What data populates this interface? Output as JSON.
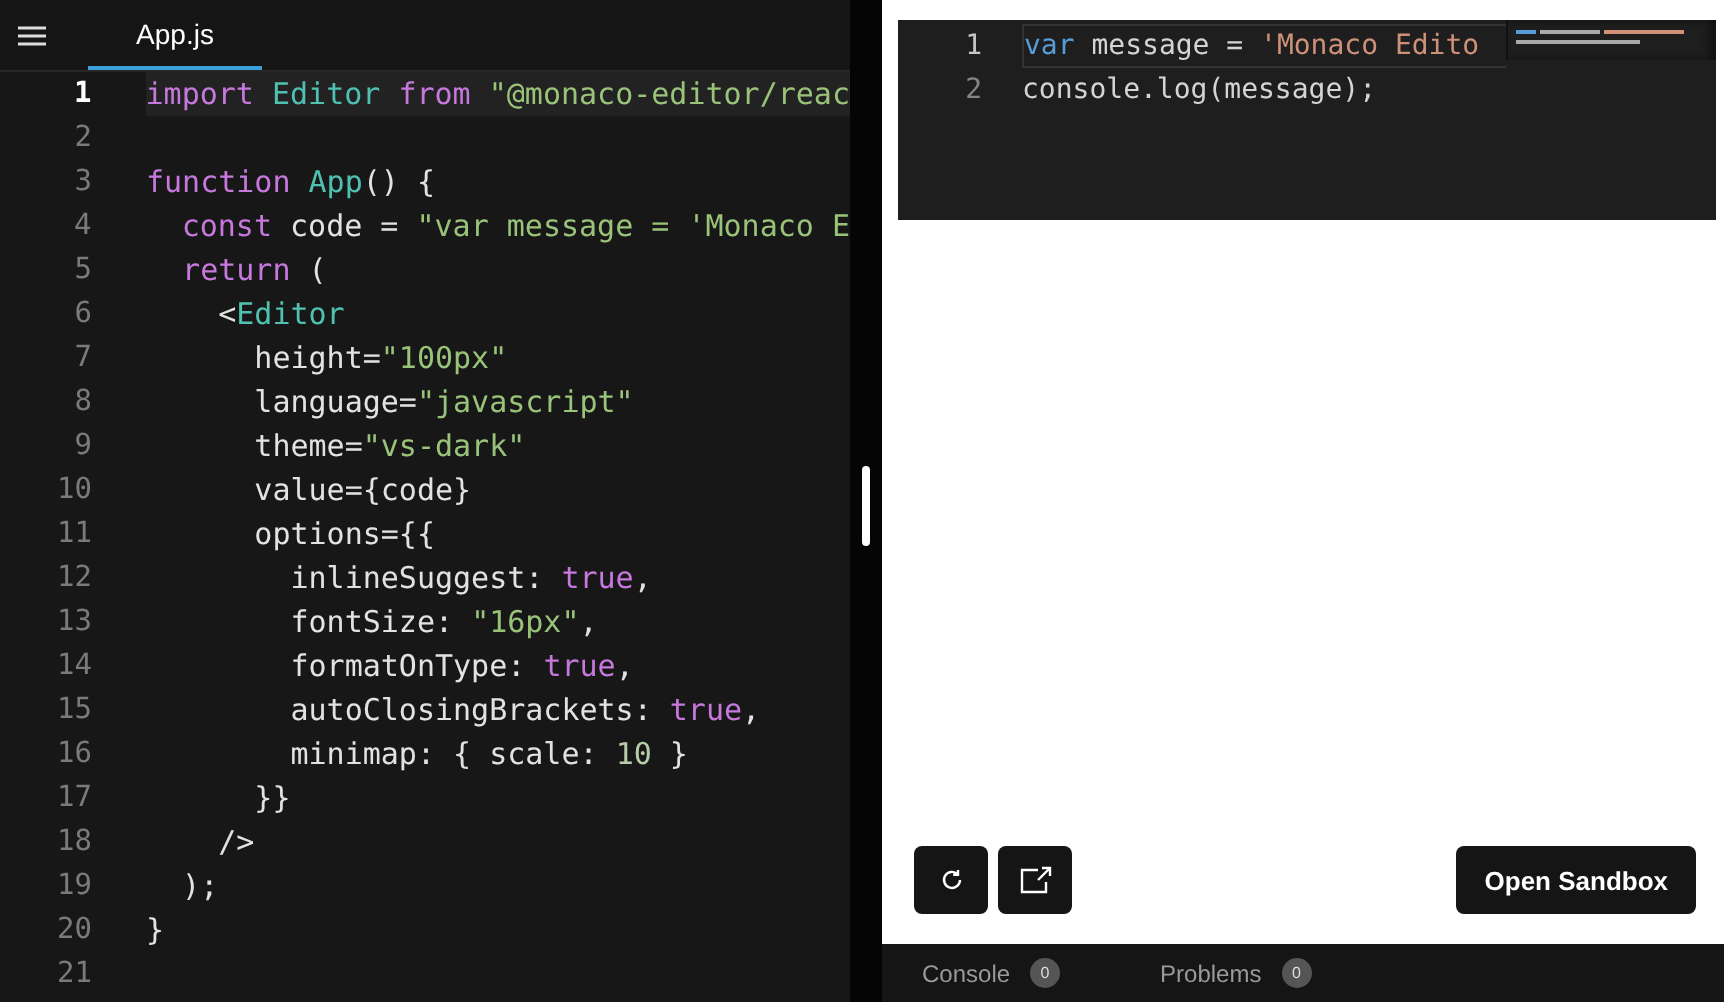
{
  "editor_tab": {
    "label": "App.js",
    "selected": true
  },
  "code_lines": [
    {
      "number": "1",
      "current": true,
      "tokens": [
        {
          "kind": "keyword",
          "text": "import"
        },
        {
          "kind": "name",
          "text": " Editor"
        },
        {
          "kind": "keyword",
          "text": " from"
        },
        {
          "kind": "string",
          "text": " \"@monaco-editor/reac"
        }
      ]
    },
    {
      "number": "2",
      "current": false
    },
    {
      "number": "3",
      "current": false,
      "tokens": [
        {
          "kind": "keyword",
          "text": "function"
        },
        {
          "kind": "name",
          "text": " App"
        },
        {
          "kind": "plain",
          "text": "() {"
        }
      ]
    },
    {
      "number": "4",
      "current": false,
      "tokens": [
        {
          "kind": "keyword",
          "text": "  const"
        },
        {
          "kind": "plain",
          "text": " code = "
        },
        {
          "kind": "string",
          "text": "\"var message = 'Monaco E"
        }
      ]
    },
    {
      "number": "5",
      "current": false,
      "tokens": [
        {
          "kind": "keyword",
          "text": "  return"
        },
        {
          "kind": "plain",
          "text": " ("
        }
      ]
    },
    {
      "number": "6",
      "current": false,
      "tokens": [
        {
          "kind": "plain",
          "text": "    <"
        },
        {
          "kind": "name",
          "text": "Editor"
        }
      ]
    },
    {
      "number": "7",
      "current": false,
      "tokens": [
        {
          "kind": "plain",
          "text": "      height="
        },
        {
          "kind": "string",
          "text": "\"100px\""
        }
      ]
    },
    {
      "number": "8",
      "current": false,
      "tokens": [
        {
          "kind": "plain",
          "text": "      language="
        },
        {
          "kind": "string",
          "text": "\"javascript\""
        }
      ]
    },
    {
      "number": "9",
      "current": false,
      "tokens": [
        {
          "kind": "plain",
          "text": "      theme="
        },
        {
          "kind": "string",
          "text": "\"vs-dark\""
        }
      ]
    },
    {
      "number": "10",
      "current": false,
      "tokens": [
        {
          "kind": "plain",
          "text": "      value={code}"
        }
      ]
    },
    {
      "number": "11",
      "current": false,
      "tokens": [
        {
          "kind": "plain",
          "text": "      options={{"
        }
      ]
    },
    {
      "number": "12",
      "current": false,
      "tokens": [
        {
          "kind": "plain",
          "text": "        inlineSuggest: "
        },
        {
          "kind": "keyword",
          "text": "true"
        },
        {
          "kind": "plain",
          "text": ","
        }
      ]
    },
    {
      "number": "13",
      "current": false,
      "tokens": [
        {
          "kind": "plain",
          "text": "        fontSize: "
        },
        {
          "kind": "string",
          "text": "\"16px\""
        },
        {
          "kind": "plain",
          "text": ","
        }
      ]
    },
    {
      "number": "14",
      "current": false,
      "tokens": [
        {
          "kind": "plain",
          "text": "        formatOnType: "
        },
        {
          "kind": "keyword",
          "text": "true"
        },
        {
          "kind": "plain",
          "text": ","
        }
      ]
    },
    {
      "number": "15",
      "current": false,
      "tokens": [
        {
          "kind": "plain",
          "text": "        autoClosingBrackets: "
        },
        {
          "kind": "keyword",
          "text": "true"
        },
        {
          "kind": "plain",
          "text": ","
        }
      ]
    },
    {
      "number": "16",
      "current": false,
      "tokens": [
        {
          "kind": "plain",
          "text": "        minimap: { scale: "
        },
        {
          "kind": "number",
          "text": "10"
        },
        {
          "kind": "plain",
          "text": " }"
        }
      ]
    },
    {
      "number": "17",
      "current": false,
      "tokens": [
        {
          "kind": "plain",
          "text": "      }}"
        }
      ]
    },
    {
      "number": "18",
      "current": false,
      "tokens": [
        {
          "kind": "plain",
          "text": "    />"
        }
      ]
    },
    {
      "number": "19",
      "current": false,
      "tokens": [
        {
          "kind": "plain",
          "text": "  );"
        }
      ]
    },
    {
      "number": "20",
      "current": false,
      "tokens": [
        {
          "kind": "plain",
          "text": "}"
        }
      ]
    },
    {
      "number": "21",
      "current": false
    }
  ],
  "preview_lines": [
    {
      "number": "1",
      "current": true,
      "tokens": [
        {
          "kind": "keyword",
          "text": "var"
        },
        {
          "kind": "plain",
          "text": " message = "
        },
        {
          "kind": "string",
          "text": "'Monaco Edito"
        }
      ]
    },
    {
      "number": "2",
      "current": false,
      "tokens": [
        {
          "kind": "plain",
          "text": "console.log(message);"
        }
      ]
    }
  ],
  "open_sandbox_button": "Open Sandbox",
  "bottom_tabs": [
    {
      "label": "Console",
      "count": "0",
      "selected": false
    },
    {
      "label": "Problems",
      "count": "0",
      "selected": false
    }
  ]
}
